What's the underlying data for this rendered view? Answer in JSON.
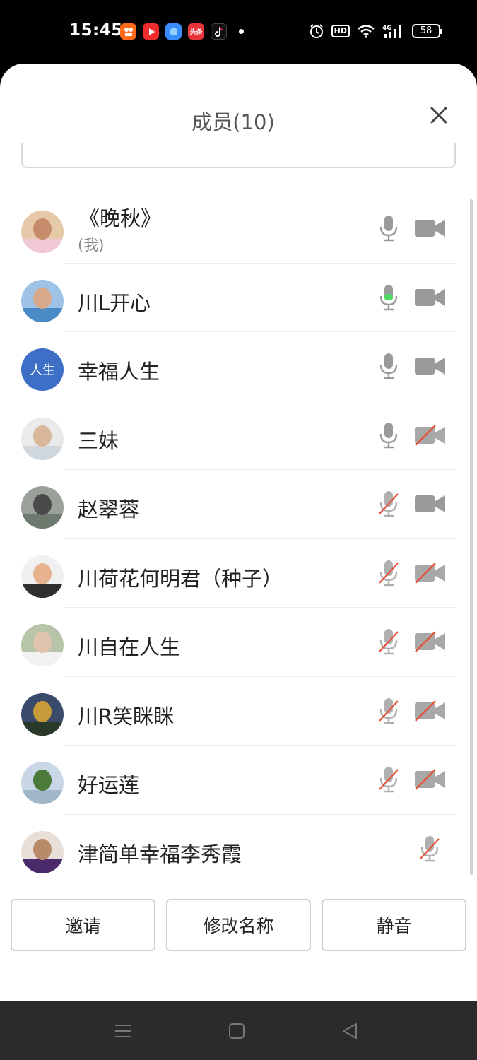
{
  "status_bar": {
    "time": "15:45",
    "app_icons": [
      "kuaishou-icon",
      "video-play-icon",
      "blue-app-icon",
      "toutiao-icon",
      "tiktok-icon"
    ],
    "toutiao_label": "头条",
    "battery": "58",
    "hd_label": "HD",
    "network": "4G"
  },
  "sheet": {
    "title": "成员(10)"
  },
  "members": [
    {
      "name": "《晚秋》",
      "sub": "(我)",
      "mic": "on",
      "camera": "on"
    },
    {
      "name": "川L开心",
      "mic": "speaking",
      "camera": "on"
    },
    {
      "name": "幸福人生",
      "avatar_text": "人生",
      "mic": "on",
      "camera": "on"
    },
    {
      "name": "三妹",
      "mic": "on",
      "camera": "off"
    },
    {
      "name": "赵翠蓉",
      "mic": "off",
      "camera": "on"
    },
    {
      "name": "川荷花何明君（种子）",
      "mic": "off",
      "camera": "off"
    },
    {
      "name": "川自在人生",
      "mic": "off",
      "camera": "off"
    },
    {
      "name": "川R笑眯眯",
      "mic": "off",
      "camera": "off"
    },
    {
      "name": "好运莲",
      "mic": "off",
      "camera": "off"
    },
    {
      "name": "津简单幸福李秀霞",
      "mic": "off",
      "camera": "none"
    }
  ],
  "buttons": {
    "invite": "邀请",
    "rename": "修改名称",
    "mute": "静音"
  },
  "colors": {
    "icon_gray": "#9a9a9a",
    "muted_red": "#e5533d",
    "speaking_green": "#4cd964",
    "avatar_blue": "#3e6fc6"
  }
}
